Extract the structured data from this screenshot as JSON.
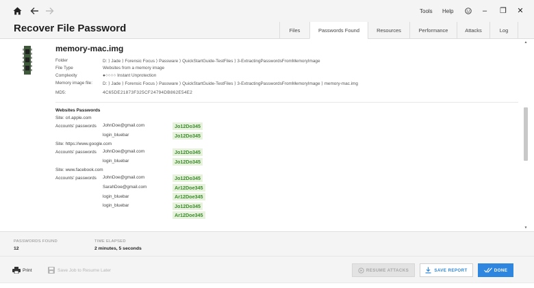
{
  "nav": {
    "home_icon": "home-icon",
    "back_icon": "arrow-left-icon",
    "forward_icon": "arrow-right-icon"
  },
  "menu": {
    "tools": "Tools",
    "help": "Help",
    "smiley_icon": "smiley-icon",
    "minimize": "–",
    "maximize": "❐",
    "close": "✕"
  },
  "header": {
    "title": "Recover File Password",
    "tabs": [
      {
        "label": "Files"
      },
      {
        "label": "Passwords Found"
      },
      {
        "label": "Resources"
      },
      {
        "label": "Performance"
      },
      {
        "label": "Attacks"
      },
      {
        "label": "Log"
      }
    ],
    "active_tab": "Passwords Found"
  },
  "file": {
    "name": "memory-mac.img",
    "icon": "memory-chip-icon",
    "meta": [
      {
        "label": "Folder",
        "value": "D: ⟩ Jade ⟩ Forensic Focus ⟩ Passware ⟩ QuickStartGuide-TestFiles ⟩ 3-ExtractingPasswordsFromMemoryImage"
      },
      {
        "label": "File Type",
        "value": "Websites from a memory image"
      },
      {
        "label": "Complexity",
        "value": "●○○○○ Instant Unprotection"
      },
      {
        "label": "Memory image file:",
        "value": "D: ⟩ Jade ⟩ Forensic Focus ⟩ Passware ⟩ QuickStartGuide-TestFiles ⟩ 3-ExtractingPasswordsFromMemoryImage ⟩ memory-mac.img"
      },
      {
        "label": "MD5:",
        "value": "4C65DE21873F325CF24794DB862E54E2"
      }
    ]
  },
  "websites": {
    "title": "Websites Passwords",
    "accounts_label": "Accounts' passwords",
    "sites": [
      {
        "site": "Site: crl.apple.com",
        "logins": [
          "JohnDoe@gmail.com",
          "login_bluebar"
        ],
        "passwords": [
          "Jo12Do345",
          "Jo12Do345"
        ]
      },
      {
        "site": "Site: https://www.google.com",
        "logins": [
          "JohnDoe@gmail.com",
          "login_bluebar"
        ],
        "passwords": [
          "Jo12Do345",
          "Jo12Do345"
        ]
      },
      {
        "site": "Site: www.facebook.com",
        "logins": [
          "JohnDoe@gmail.com",
          "SarahDoe@gmail.com",
          "login_bluebar",
          "login_bluebar"
        ],
        "passwords": [
          "Jo12Do345",
          "Ar12Doe345",
          "Ar12Doe345",
          "Jo12Do345",
          "Ar12Doe345"
        ]
      }
    ]
  },
  "status": {
    "passwords_found_label": "PASSWORDS FOUND",
    "passwords_found_value": "12",
    "time_elapsed_label": "TIME ELAPSED",
    "time_elapsed_value": "2 minutes, 5 seconds"
  },
  "actions": {
    "print": "Print",
    "save_job": "Save Job to Resume Later",
    "resume": "RESUME ATTACKS",
    "save_report": "SAVE REPORT",
    "done": "DONE"
  },
  "colors": {
    "accent": "#2e86de",
    "password_bg": "#e6f2dc",
    "password_text": "#3a8a2a"
  }
}
